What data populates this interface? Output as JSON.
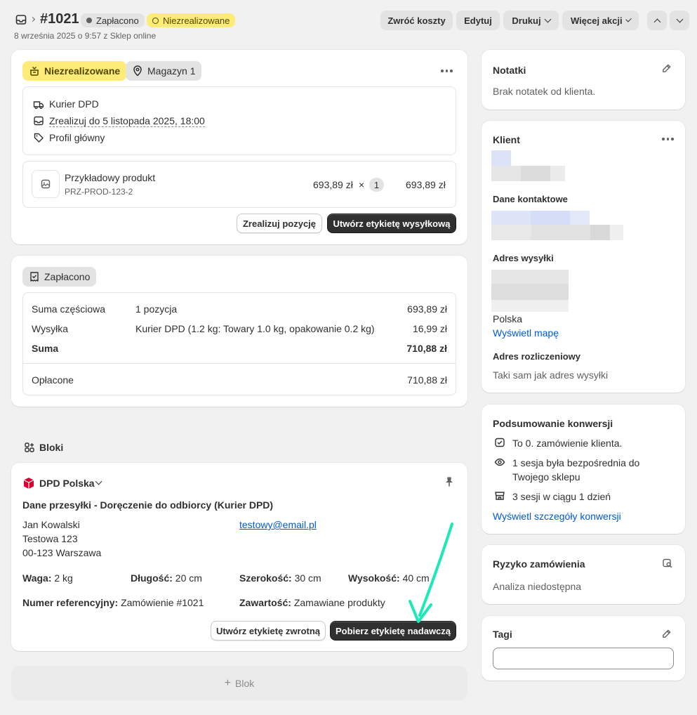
{
  "header": {
    "order_number": "#1021",
    "payment_badge": "Zapłacono",
    "fulfillment_badge": "Niezrealizowane",
    "subtitle": "8 września 2025 o 9:57 z Sklep online",
    "actions": {
      "refund": "Zwróć koszty",
      "edit": "Edytuj",
      "print": "Drukuj",
      "more": "Więcej akcji"
    }
  },
  "fulfillment": {
    "status": "Niezrealizowane",
    "location": "Magazyn 1",
    "carrier": "Kurier DPD",
    "deadline": "Zrealizuj do 5 listopada 2025, 18:00",
    "profile": "Profil główny",
    "product": {
      "name": "Przykładowy produkt",
      "sku": "PRZ-PROD-123-2",
      "unit_price": "693,89 zł",
      "times": "×",
      "qty": "1",
      "total": "693,89 zł"
    },
    "fulfill_button": "Zrealizuj pozycję",
    "label_button": "Utwórz etykietę wysyłkową"
  },
  "payment": {
    "status": "Zapłacono",
    "rows": [
      {
        "label": "Suma częściowa",
        "desc": "1 pozycja",
        "amount": "693,89 zł"
      },
      {
        "label": "Wysyłka",
        "desc": "Kurier DPD (1.2 kg: Towary 1.0 kg, opakowanie 0.2 kg)",
        "amount": "16,99 zł"
      },
      {
        "label": "Suma",
        "desc": "",
        "amount": "710,88 zł"
      }
    ],
    "paid_label": "Opłacone",
    "paid_amount": "710,88 zł"
  },
  "blocks": {
    "title": "Bloki",
    "add_label": "Blok",
    "dpd": {
      "provider": "DPD Polska",
      "shipment_title": "Dane przesyłki - Doręczenie do odbiorcy (Kurier DPD)",
      "recipient": {
        "name": "Jan Kowalski",
        "street": "Testowa 123",
        "city": "00-123 Warszawa",
        "email": "testowy@email.pl"
      },
      "weight_label": "Waga:",
      "weight": "2 kg",
      "length_label": "Długość:",
      "length": "20 cm",
      "width_label": "Szerokość:",
      "width": "30 cm",
      "height_label": "Wysokość:",
      "height": "40 cm",
      "ref_label": "Numer referencyjny:",
      "ref": "Zamówienie #1021",
      "content_label": "Zawartość:",
      "content": "Zamawiane produkty",
      "return_label_button": "Utwórz etykietę zwrotną",
      "download_label_button": "Pobierz etykietę nadawczą"
    }
  },
  "notes": {
    "title": "Notatki",
    "text": "Brak notatek od klienta."
  },
  "customer": {
    "title": "Klient",
    "contact_title": "Dane kontaktowe",
    "shipping_title": "Adres wysyłki",
    "country": "Polska",
    "map_link": "Wyświetl mapę",
    "billing_title": "Adres rozliczeniowy",
    "billing_text": "Taki sam jak adres wysyłki"
  },
  "conversion": {
    "title": "Podsumowanie konwersji",
    "line1": "To 0. zamówienie klienta.",
    "line2a": "1 sesja była bezpośrednia do",
    "line2b": "Twojego sklepu",
    "line3": "3 sesji w ciągu 1 dzień",
    "link": "Wyświetl szczegóły konwersji"
  },
  "risk": {
    "title": "Ryzyko zamówienia",
    "text": "Analiza niedostępna"
  },
  "tags": {
    "title": "Tagi",
    "input_value": ""
  },
  "colors": {
    "accent_dark": "#303030",
    "link": "#005bd3",
    "warning_bg": "#ffeb78",
    "teal_arrow": "#1de9b6",
    "dpd_red": "#dc0032"
  }
}
